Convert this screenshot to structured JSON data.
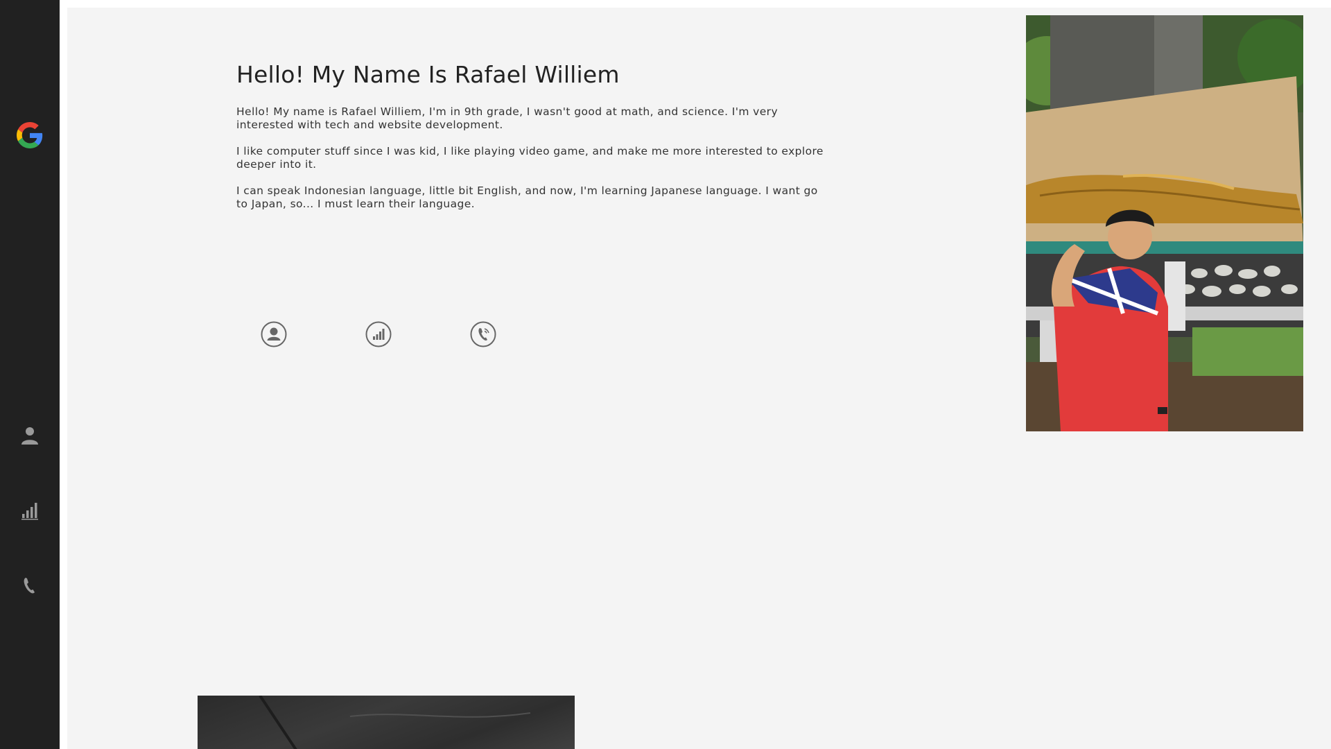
{
  "sidebar": {
    "logo_icon": "google-g-logo",
    "items": [
      {
        "icon": "user-icon"
      },
      {
        "icon": "bar-chart-icon"
      },
      {
        "icon": "phone-icon"
      }
    ]
  },
  "about": {
    "title": "Hello! My Name Is Rafael Williem",
    "paragraphs": [
      "Hello! My name is Rafael Williem, I'm in 9th grade, I wasn't good at math, and science. I'm very interested with tech and website development.",
      "I like computer stuff since I was kid, I like playing video game, and make me more interested to explore deeper into it.",
      "I can speak Indonesian language, little bit English, and now, I'm learning Japanese language. I want go to Japan, so... I must learn their language."
    ],
    "links": [
      {
        "icon": "user-circle-icon"
      },
      {
        "icon": "chart-circle-icon"
      },
      {
        "icon": "phone-circle-icon"
      }
    ]
  },
  "colors": {
    "sidebar_bg": "#212121",
    "page_bg": "#f4f4f4",
    "icon_gray": "#666666"
  }
}
